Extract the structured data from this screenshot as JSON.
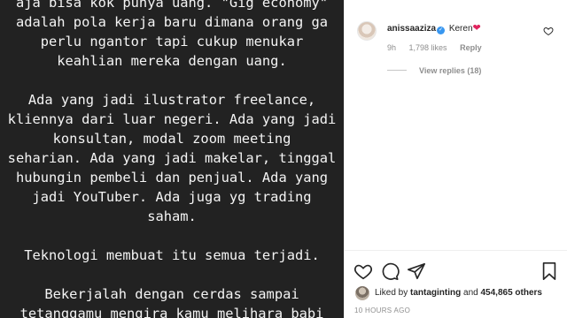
{
  "post": {
    "lines": [
      "aja bisa kok punya uang. \"Gig economy\"",
      "adalah pola kerja baru dimana orang ga",
      "perlu ngantor tapi cukup menukar",
      "keahlian mereka dengan uang.",
      "",
      "Ada yang jadi ilustrator freelance,",
      "kliennya dari luar negeri. Ada yang jadi",
      "konsultan, modal zoom meeting",
      "seharian. Ada yang jadi makelar, tinggal",
      "hubungin pembeli dan penjual. Ada yang",
      "jadi YouTuber. Ada juga yg trading",
      "saham.",
      "",
      "Teknologi membuat itu semua terjadi.",
      "",
      "Bekerjalah dengan cerdas sampai",
      "tetanggamu mengira kamu melihara babi"
    ]
  },
  "comment": {
    "username": "anissaaziza",
    "verified_mark": "✓",
    "text": "Keren",
    "emoji": "❤",
    "time": "9h",
    "likes": "1,798 likes",
    "reply_label": "Reply",
    "view_replies": "View replies (18)"
  },
  "likes_row": {
    "prefix": "Liked by ",
    "user": "tantaginting",
    "middle": " and ",
    "count": "454,865 others"
  },
  "timestamp": "10 HOURS AGO",
  "icons": [
    "heart-icon",
    "comment-icon",
    "share-icon",
    "bookmark-icon"
  ],
  "colors": {
    "post_bg": "#222222",
    "link_blue": "#3897f0",
    "meta_gray": "#8e8e8e"
  }
}
